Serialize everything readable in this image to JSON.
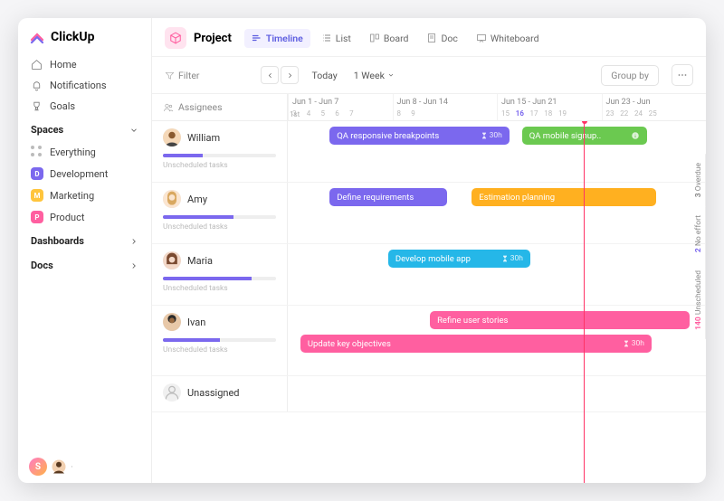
{
  "logo": "ClickUp",
  "nav": {
    "home": "Home",
    "notifications": "Notifications",
    "goals": "Goals"
  },
  "spaces_head": "Spaces",
  "spaces": {
    "everything": "Everything",
    "development": "Development",
    "dev_letter": "D",
    "marketing": "Marketing",
    "mkt_letter": "M",
    "product": "Product",
    "prd_letter": "P"
  },
  "dashboards": "Dashboards",
  "docs": "Docs",
  "user_initial": "S",
  "project": "Project",
  "views": {
    "timeline": "Timeline",
    "list": "List",
    "board": "Board",
    "doc": "Doc",
    "whiteboard": "Whiteboard"
  },
  "toolbar": {
    "filter": "Filter",
    "today": "Today",
    "range": "1 Week",
    "group": "Group by"
  },
  "assignees_label": "Assignees",
  "weeks": [
    "Jun 1 - Jun 7",
    "Jun 8 - Jun 14",
    "Jun 15 - Jun 21",
    "Jun 23 - Jun"
  ],
  "count_label": "1st",
  "today_day": "16",
  "unscheduled_label": "Unscheduled tasks",
  "people": {
    "william": "William",
    "amy": "Amy",
    "maria": "Maria",
    "ivan": "Ivan",
    "unassigned": "Unassigned"
  },
  "tasks": {
    "qa_resp": {
      "label": "QA responsive breakpoints",
      "hours": "30h"
    },
    "qa_mobile": {
      "label": "QA mobile signup.."
    },
    "define": {
      "label": "Define requirements"
    },
    "estimation": {
      "label": "Estimation planning"
    },
    "develop": {
      "label": "Develop mobile app",
      "hours": "30h"
    },
    "refine": {
      "label": "Refine user stories"
    },
    "update": {
      "label": "Update key objectives",
      "hours": "30h"
    }
  },
  "badges": {
    "overdue_n": "3",
    "overdue": "Overdue",
    "noeffort_n": "2",
    "noeffort": "No effort",
    "unsched_n": "140",
    "unsched": "Unscheduled"
  },
  "colors": {
    "overdue": "#ffb020",
    "noeffort": "#7b68ee",
    "unsched": "#ff5fa0"
  }
}
